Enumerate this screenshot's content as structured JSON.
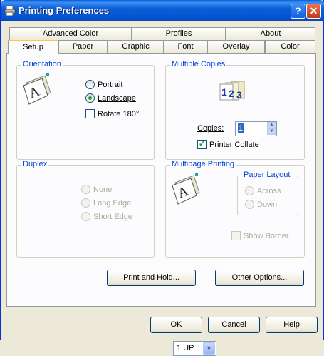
{
  "window": {
    "title": "Printing Preferences",
    "help_btn": "?",
    "close_btn": "✕"
  },
  "tabs_back": [
    "Advanced Color",
    "Profiles",
    "About"
  ],
  "tabs_front": [
    "Setup",
    "Paper",
    "Graphic",
    "Font",
    "Overlay",
    "Color"
  ],
  "orientation": {
    "label": "Orientation",
    "portrait": "Portrait",
    "landscape": "Landscape",
    "rotate": "Rotate 180°"
  },
  "copies": {
    "label": "Multiple Copies",
    "copies_label": "Copies:",
    "copies_value": "1",
    "collate": "Printer Collate",
    "collate_checked": "✓"
  },
  "duplex": {
    "label": "Duplex",
    "none": "None",
    "long": "Long Edge",
    "short": "Short Edge"
  },
  "multipage": {
    "label": "Multipage Printing",
    "layout_label": "Paper Layout",
    "across": "Across",
    "down": "Down",
    "nup": "1 UP",
    "show_border": "Show Border"
  },
  "buttons": {
    "print_hold": "Print and Hold...",
    "other": "Other Options...",
    "ok": "OK",
    "cancel": "Cancel",
    "help": "Help"
  }
}
